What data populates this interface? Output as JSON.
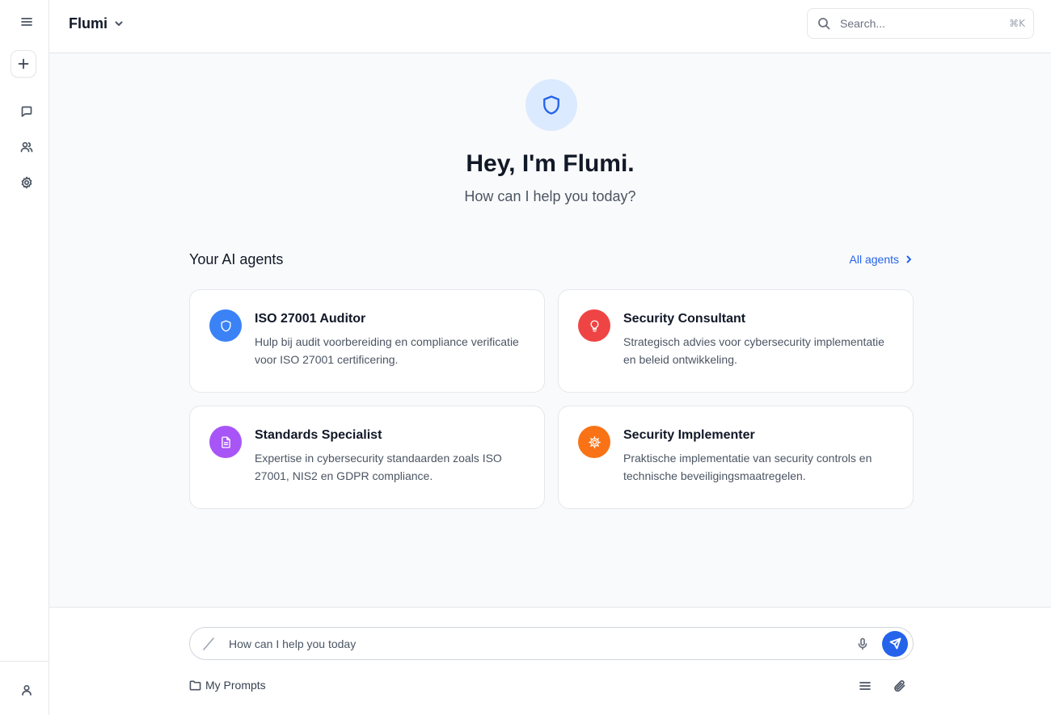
{
  "app": {
    "name": "Flumi"
  },
  "search": {
    "placeholder": "Search...",
    "shortcut": "⌘K"
  },
  "sidebar": {
    "items": [
      {
        "icon": "menu-icon",
        "label": "Menu"
      },
      {
        "icon": "plus-icon",
        "label": "New chat"
      },
      {
        "icon": "chat-icon",
        "label": "Chats"
      },
      {
        "icon": "users-icon",
        "label": "Agents"
      },
      {
        "icon": "gear-icon",
        "label": "Settings"
      },
      {
        "icon": "user-icon",
        "label": "Profile"
      }
    ]
  },
  "hero": {
    "icon": "shield-icon",
    "title": "Hey, I'm Flumi.",
    "subtitle": "How can I help you today?"
  },
  "agents": {
    "title": "Your AI agents",
    "all_label": "All agents",
    "items": [
      {
        "title": "ISO 27001 Auditor",
        "description": "Hulp bij audit voorbereiding en compliance verificatie voor ISO 27001 certificering.",
        "icon": "shield-icon",
        "color": "#3b82f6"
      },
      {
        "title": "Security Consultant",
        "description": "Strategisch advies voor cybersecurity implementatie en beleid ontwikkeling.",
        "icon": "lightbulb-icon",
        "color": "#ef4444"
      },
      {
        "title": "Standards Specialist",
        "description": "Expertise in cybersecurity standaarden zoals ISO 27001, NIS2 en GDPR compliance.",
        "icon": "document-icon",
        "color": "#a855f7"
      },
      {
        "title": "Security Implementer",
        "description": "Praktische implementatie van security controls en technische beveiligingsmaatregelen.",
        "icon": "cog-icon",
        "color": "#f97316"
      }
    ]
  },
  "composer": {
    "placeholder": "How can I help you today",
    "my_prompts": "My Prompts"
  },
  "colors": {
    "accent": "#2563eb",
    "hero_bg": "#dbeafe"
  }
}
